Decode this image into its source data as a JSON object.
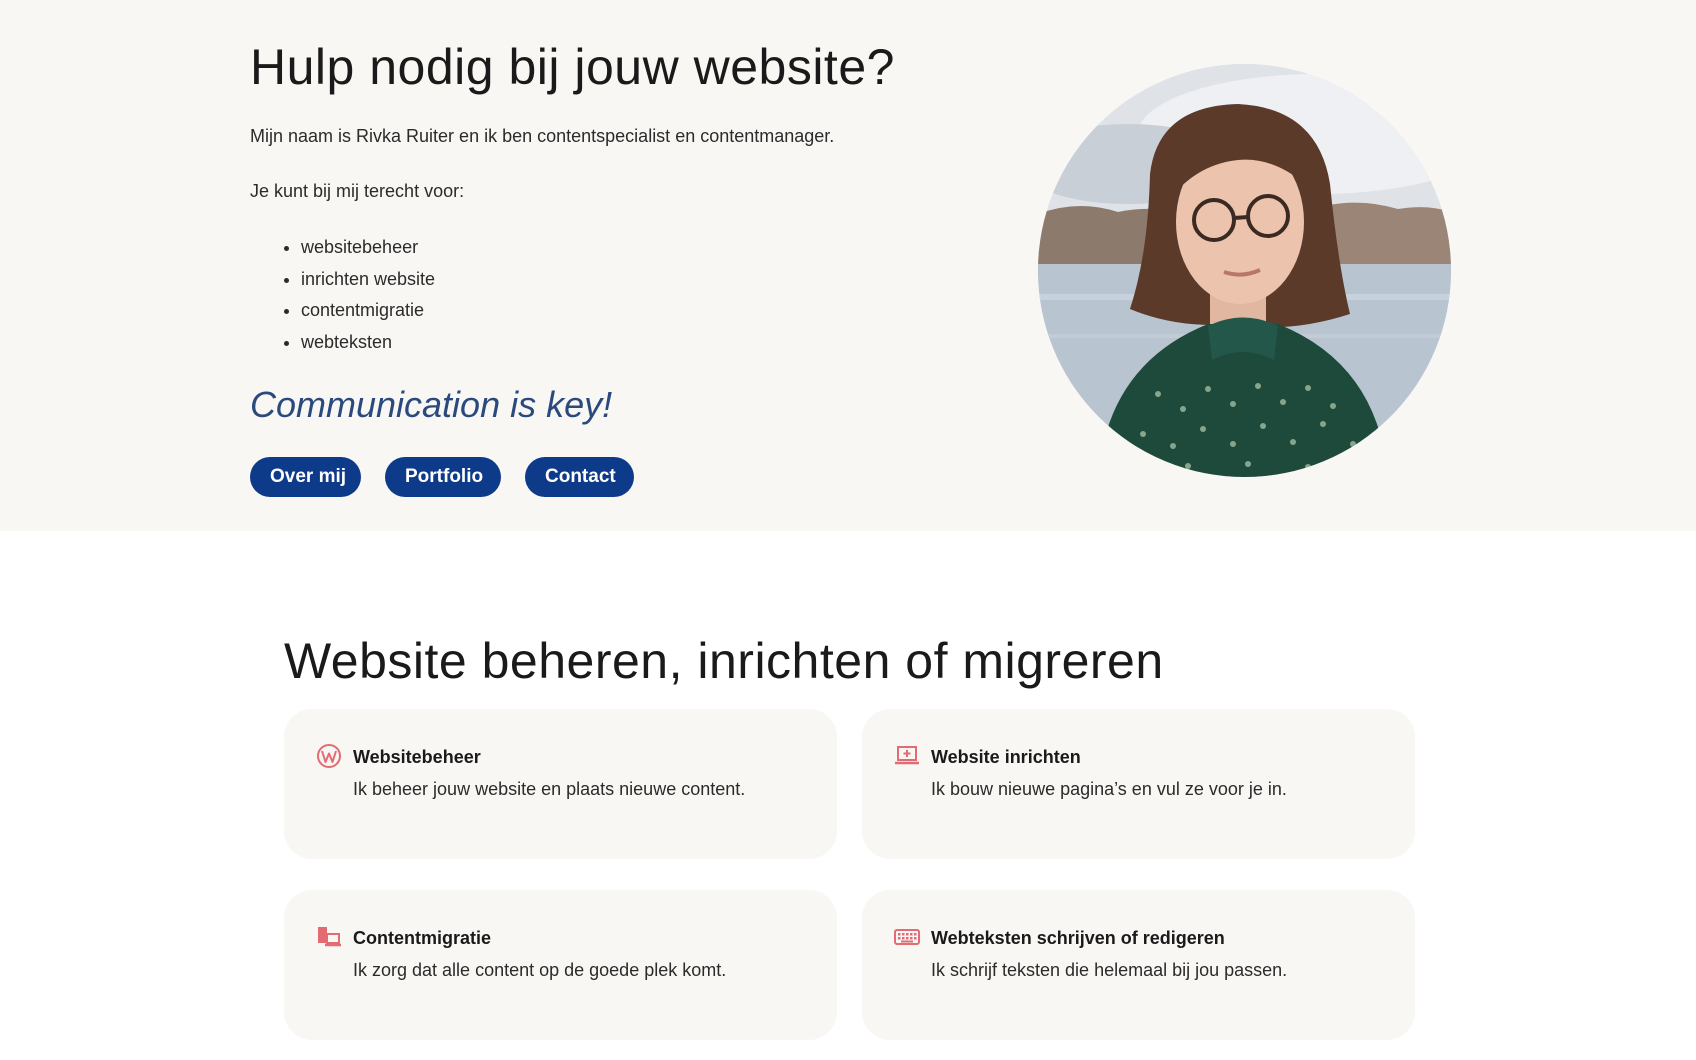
{
  "hero": {
    "title": "Hulp nodig bij jouw website?",
    "intro": "Mijn naam is Rivka Ruiter en ik ben contentspecialist en contentmanager.",
    "sub": "Je kunt bij mij terecht voor:",
    "services": [
      "websitebeheer",
      "inrichten website",
      "contentmigratie",
      "webteksten"
    ],
    "tagline": "Communication is key!",
    "buttons": {
      "about": "Over mij",
      "portfolio": "Portfolio",
      "contact": "Contact"
    }
  },
  "section": {
    "title": "Website beheren, inrichten of migreren",
    "cards": [
      {
        "icon": "wordpress-icon",
        "title": "Websitebeheer",
        "text": "Ik beheer jouw website en plaats nieuwe content."
      },
      {
        "icon": "laptop-add-icon",
        "title": "Website inrichten",
        "text": "Ik bouw nieuwe pagina’s en vul ze voor je in."
      },
      {
        "icon": "devices-icon",
        "title": "Contentmigratie",
        "text": "Ik zorg dat alle content op de goede plek komt."
      },
      {
        "icon": "keyboard-icon",
        "title": "Webteksten schrijven of redigeren",
        "text": "Ik schrijf teksten die helemaal bij jou passen."
      }
    ]
  },
  "colors": {
    "hero_background": "#f8f7f4",
    "button": "#0e3a8a",
    "tagline": "#2a4a7d",
    "icon_accent": "#e36b74",
    "card_background": "#f8f7f4"
  }
}
